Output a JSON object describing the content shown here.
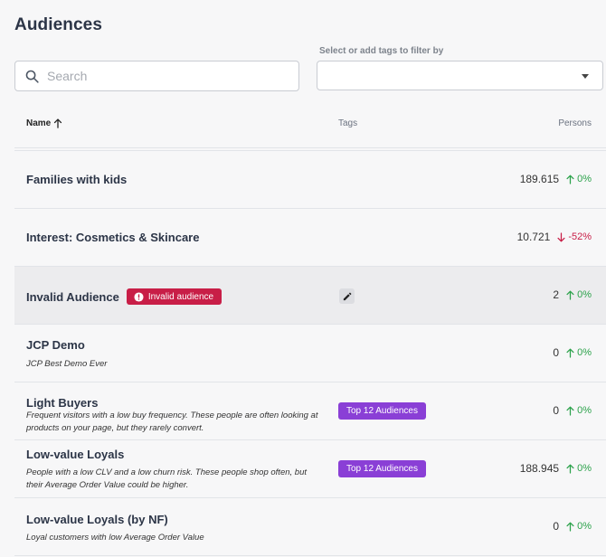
{
  "page": {
    "title": "Audiences"
  },
  "search": {
    "placeholder": "Search",
    "value": ""
  },
  "filter": {
    "label": "Select or add tags to filter by",
    "value": ""
  },
  "table": {
    "columns": {
      "name": "Name",
      "tags": "Tags",
      "persons": "Persons"
    },
    "rows": [
      {
        "name": "Families with kids",
        "description": "",
        "tag": "",
        "count": "189.615",
        "trend": "0%",
        "direction": "up"
      },
      {
        "name": "Interest: Cosmetics & Skincare",
        "description": "",
        "tag": "",
        "count": "10.721",
        "trend": "-52%",
        "direction": "down"
      },
      {
        "name": "Invalid Audience",
        "badge": "Invalid audience",
        "description": "",
        "tag": "",
        "count": "2",
        "trend": "0%",
        "direction": "up"
      },
      {
        "name": "JCP Demo",
        "description": "JCP Best Demo Ever",
        "tag": "",
        "count": "0",
        "trend": "0%",
        "direction": "up"
      },
      {
        "name": "Light Buyers",
        "description": "Frequent visitors with a low buy frequency. These people are often looking at products on your page, but they rarely convert.",
        "tag": "Top 12 Audiences",
        "count": "0",
        "trend": "0%",
        "direction": "up"
      },
      {
        "name": "Low-value Loyals",
        "description": "People with a low CLV and a low churn risk. These people shop often, but their Average Order Value could be higher.",
        "tag": "Top 12 Audiences",
        "count": "188.945",
        "trend": "0%",
        "direction": "up"
      },
      {
        "name": "Low-value Loyals (by NF)",
        "description": "Loyal customers with low Average Order Value",
        "tag": "",
        "count": "0",
        "trend": "0%",
        "direction": "up"
      }
    ]
  },
  "colors": {
    "accent_purple": "#8a3fd6",
    "error_red": "#c81e47",
    "trend_up_green": "#2ca24b",
    "trend_down_red": "#c81e47"
  },
  "icons": {
    "search": "search-icon",
    "sort": "arrow-up-icon",
    "dropdown": "chevron-down-icon",
    "error": "alert-circle-icon",
    "edit": "pencil-icon",
    "trend_up": "arrow-up-icon",
    "trend_down": "arrow-down-icon"
  }
}
